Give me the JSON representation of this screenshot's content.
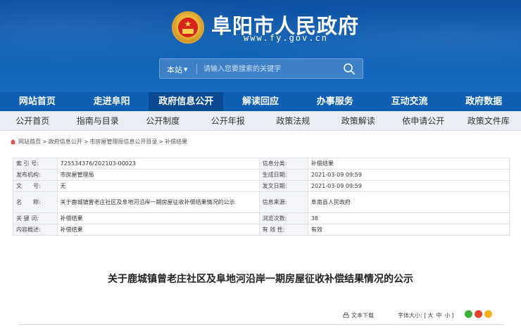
{
  "header": {
    "site_title": "阜阳市人民政府",
    "site_url": "www.fy.gov.cn",
    "search_scope": "本站",
    "search_placeholder": "请输入您要搜索的关键字"
  },
  "main_nav": [
    {
      "label": "网站首页"
    },
    {
      "label": "走进阜阳"
    },
    {
      "label": "政府信息公开",
      "active": true
    },
    {
      "label": "解读回应"
    },
    {
      "label": "办事服务"
    },
    {
      "label": "互动交流"
    },
    {
      "label": "政府数据"
    }
  ],
  "sub_nav": [
    {
      "label": "公开首页"
    },
    {
      "label": "指南与目录"
    },
    {
      "label": "公开制度"
    },
    {
      "label": "公开年报"
    },
    {
      "label": "政策法规"
    },
    {
      "label": "政策解读"
    },
    {
      "label": "依申请公开"
    },
    {
      "label": "政策文件库"
    }
  ],
  "breadcrumb": [
    "网站首页",
    "政府信息公开",
    "市房屋管理局信息公开目录",
    "补偿结果"
  ],
  "info": {
    "index_label": "索 引 号:",
    "index_value": "725534376/202103-00023",
    "category_label": "信息分类:",
    "category_value": "补偿结果",
    "publisher_label": "发布机构:",
    "publisher_value": "市房屋管理局",
    "created_label": "生成日期:",
    "created_value": "2021-03-09 09:59",
    "docno_label": "文　　号:",
    "docno_value": "无",
    "published_label": "发文日期:",
    "published_value": "2021-03-09 09:59",
    "name_label": "名　　称:",
    "name_value": "关于鹿城镇曾老庄社区及阜地河沿岸一期房屋征收补偿结果情况的公示",
    "source_label": "信息来源:",
    "source_value": "阜南县人民政府",
    "keywords_label": "关 键 词:",
    "keywords_value": "补偿结果",
    "views_label": "浏览次数:",
    "views_value": "38",
    "summary_label": "内容概述:",
    "summary_value": "补偿结果",
    "validity_label": "有 效 性:",
    "validity_value": "有效"
  },
  "article": {
    "title": "关于鹿城镇曾老庄社区及阜地河沿岸一期房屋征收补偿结果情况的公示",
    "download_label": "文本下载",
    "fontsize_label": "字体大小:",
    "fontsize_open": "[",
    "fontsize_large": "大",
    "fontsize_medium": "中",
    "fontsize_small": "小",
    "fontsize_close": "]"
  },
  "colors": {
    "header_blue": "#1163b8",
    "nav_blue": "#0f5fb4",
    "nav_active": "#0a4a92",
    "share_wechat": "#3cb034",
    "share_weibo": "#e8402f",
    "share_qzone": "#f4b21a"
  }
}
